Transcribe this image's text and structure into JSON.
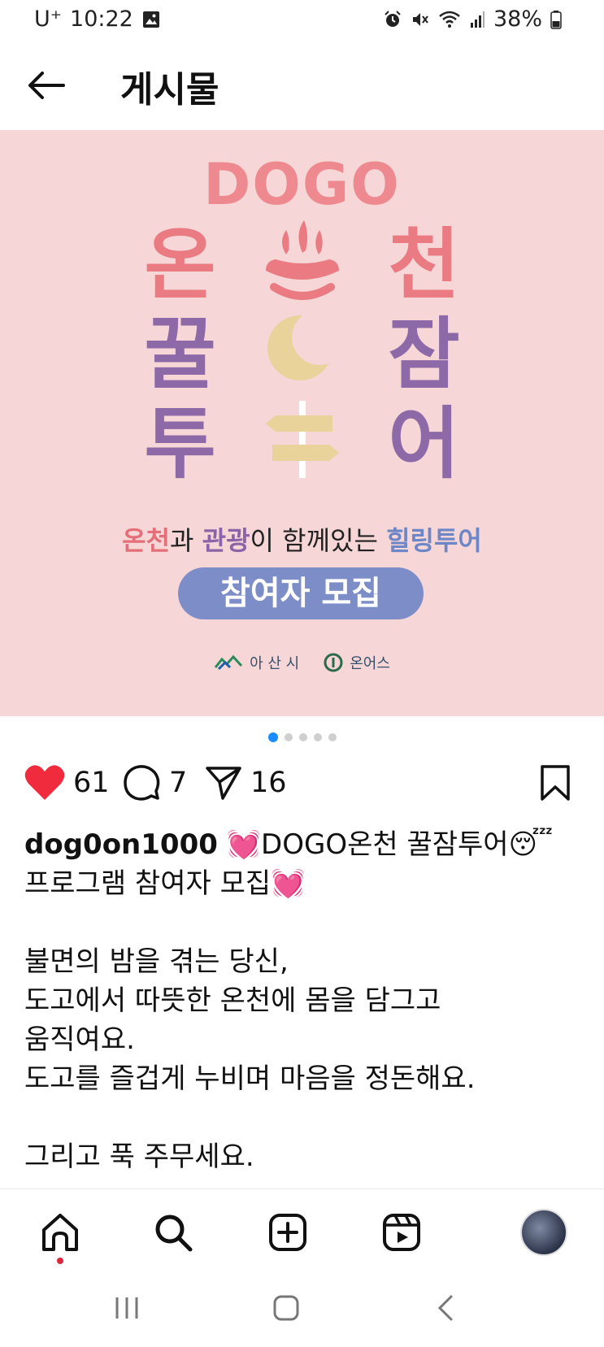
{
  "status_bar": {
    "carrier": "U⁺",
    "time": "10:22",
    "battery": "38%",
    "icons": [
      "image-icon",
      "alarm-icon",
      "mute-icon",
      "wifi-icon",
      "signal-icon",
      "battery-icon"
    ]
  },
  "header": {
    "title": "게시물"
  },
  "post_image": {
    "brand": "DOGO",
    "row1": [
      "온",
      "천"
    ],
    "row2": [
      "꿀",
      "잠"
    ],
    "row3": [
      "투",
      "어"
    ],
    "subtitle": {
      "part1": "온천",
      "part2": "과 ",
      "part3": "관광",
      "part4": "이 함께있는 ",
      "part5": "힐링투어"
    },
    "recruit_button": "참여자 모집",
    "logo_left": "아 산 시",
    "logo_right": "온어스",
    "colors": {
      "background": "#f6d6d6",
      "pink": "#ea7b82",
      "purple": "#8d6aa7",
      "blue": "#7d8dc8"
    }
  },
  "carousel": {
    "total": 5,
    "active": 1
  },
  "actions": {
    "likes": "61",
    "comments": "7",
    "shares": "16"
  },
  "caption": {
    "username": "dog0on1000",
    "line1": " 💓DOGO온천 꿀잠투어😴",
    "line2": "프로그램 참여자 모집💓",
    "line3": "",
    "line4": "불면의 밤을 겪는 당신,",
    "line5": "도고에서 따뜻한 온천에 몸을 담그고",
    "line6": "움직여요.",
    "line7": "도고를 즐겁게 누비며 마음을 정돈해요.",
    "line8": "",
    "line9": "그리고 푹  주무세요."
  },
  "bottom_nav": {
    "items": [
      "home-icon",
      "search-icon",
      "create-icon",
      "reels-icon",
      "profile-avatar"
    ]
  }
}
